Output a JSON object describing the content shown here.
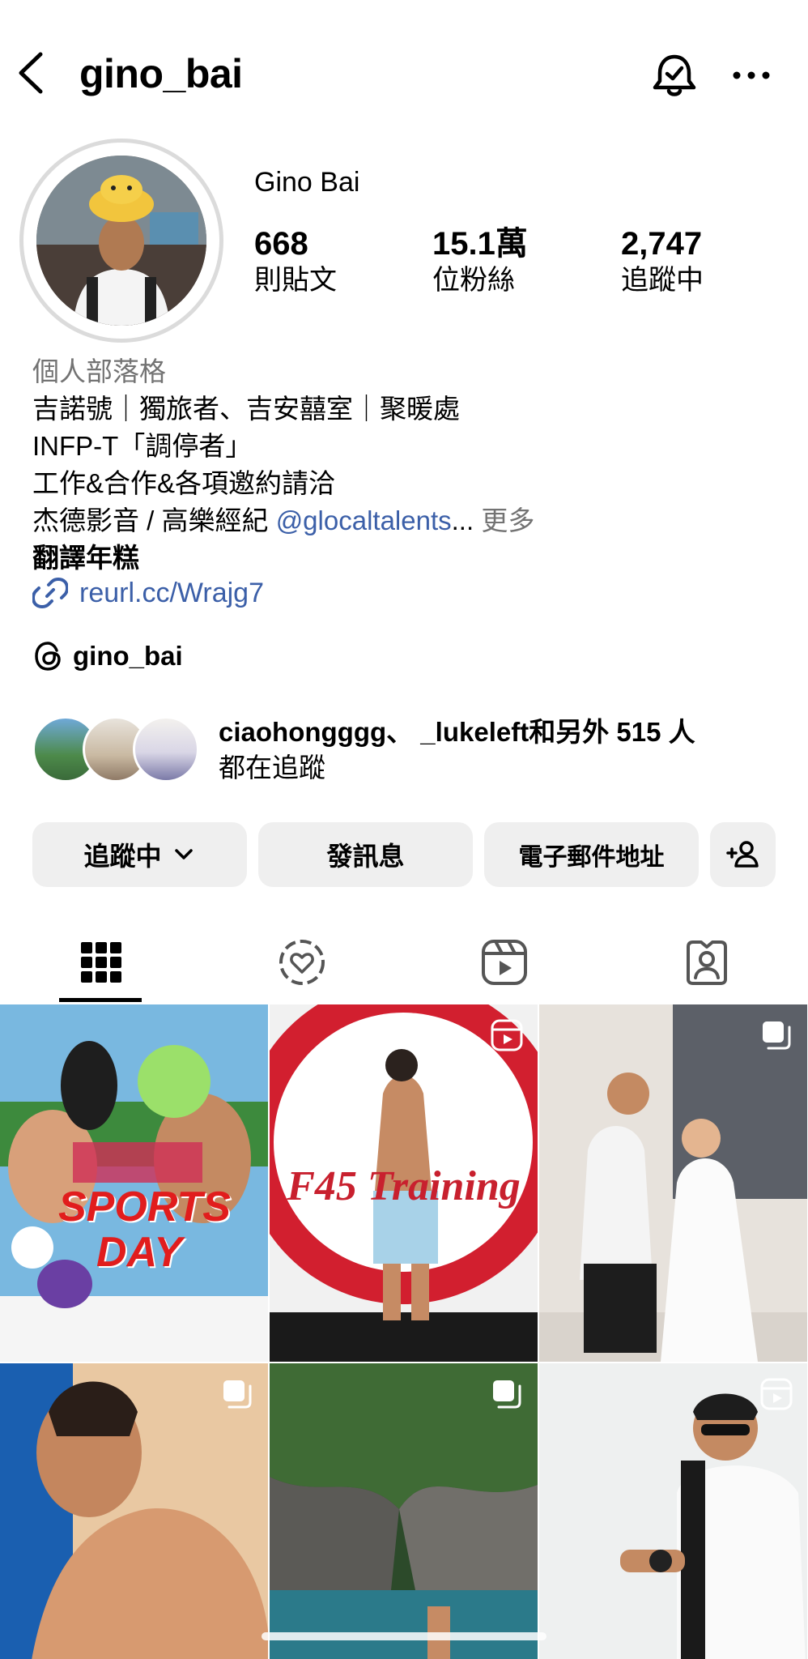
{
  "header": {
    "username": "gino_bai"
  },
  "profile": {
    "display_name": "Gino Bai",
    "stats": [
      {
        "value": "668",
        "label": "則貼文"
      },
      {
        "value": "15.1萬",
        "label": "位粉絲"
      },
      {
        "value": "2,747",
        "label": "追蹤中"
      }
    ],
    "bio": {
      "category": "個人部落格",
      "line1": "吉諾號｜獨旅者、吉安囍室｜聚暖處",
      "line2": "INFP-T「調停者」",
      "line3": "工作&合作&各項邀約請洽",
      "line4_prefix": "杰德影音 / 高樂經紀 ",
      "line4_link": "@glocaltalents",
      "line4_ellipsis": "...",
      "more": " 更多",
      "line5": "翻譯年糕"
    },
    "url": "reurl.cc/Wrajg7",
    "threads_handle": "gino_bai",
    "mutual": {
      "names": "ciaohongggg、 _lukeleft",
      "rest": "和另外 515 人",
      "line2": "都在追蹤"
    }
  },
  "actions": {
    "following": "追蹤中",
    "message": "發訊息",
    "email": "電子郵件地址"
  },
  "grid_posts": [
    {
      "name": "post-sports-day",
      "text": "SPORTS DAY",
      "badge": ""
    },
    {
      "name": "post-f45-training",
      "text": "F45 Training",
      "badge": "reel"
    },
    {
      "name": "post-wedding",
      "text": "",
      "badge": "carousel"
    },
    {
      "name": "post-sunbathing",
      "text": "",
      "badge": "carousel"
    },
    {
      "name": "post-gorge",
      "text": "",
      "badge": "carousel"
    },
    {
      "name": "post-watch",
      "text": "",
      "badge": "reel"
    }
  ],
  "colors": {
    "link": "#3b5fa8",
    "secondary": "#737373",
    "button_bg": "#efefef"
  }
}
